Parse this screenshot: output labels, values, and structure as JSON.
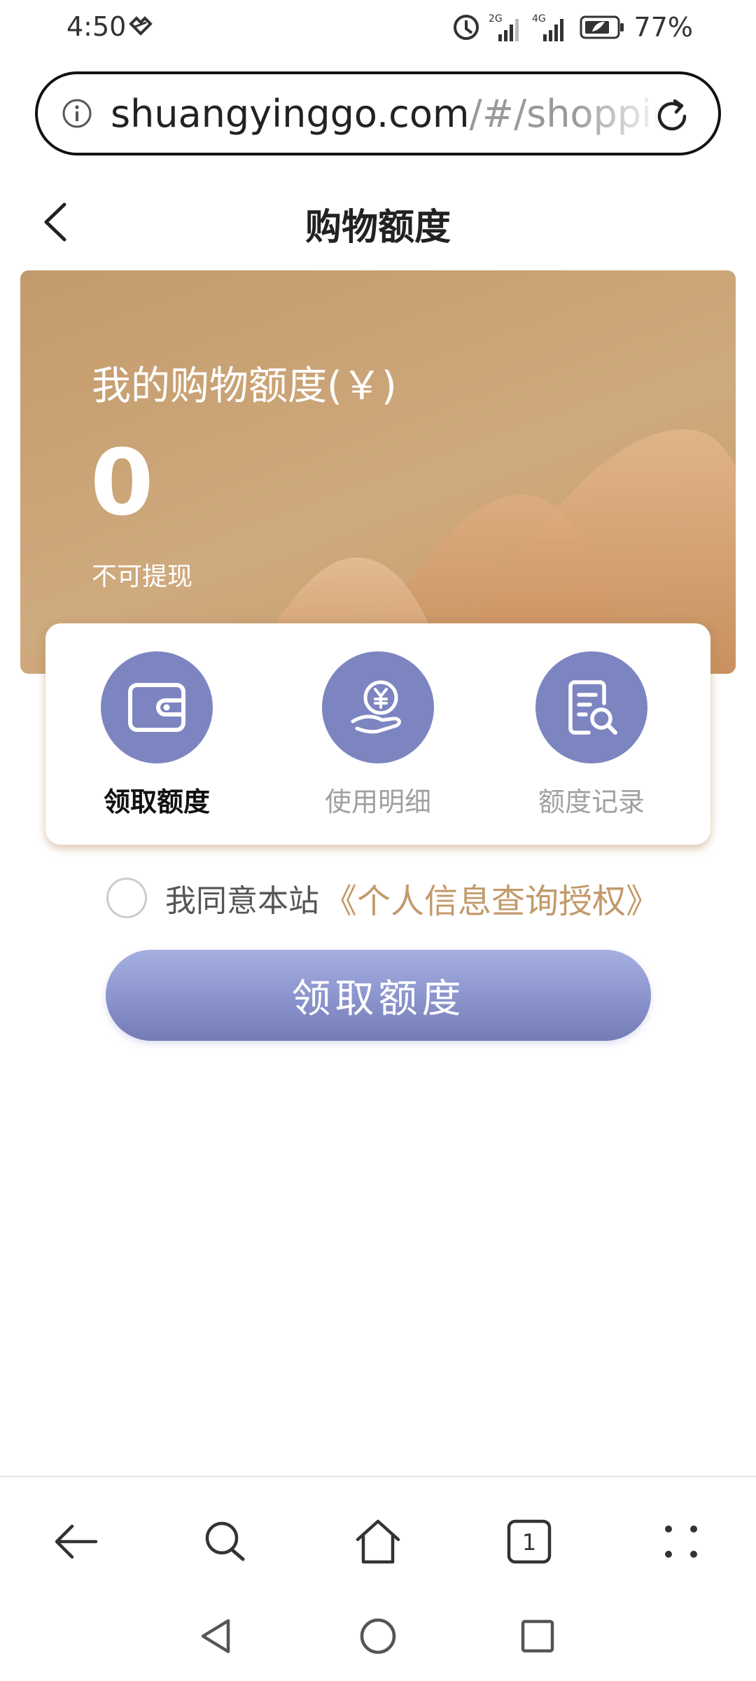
{
  "status_bar": {
    "time": "4:50",
    "network_1": "2G",
    "network_2": "4G",
    "battery_percent": "77%"
  },
  "url_bar": {
    "host": "shuangyinggo.com",
    "path": "/#/shoppir"
  },
  "header": {
    "title": "购物额度"
  },
  "banner": {
    "label": "我的购物额度(￥)",
    "amount": "0",
    "note": "不可提现"
  },
  "actions": [
    {
      "label": "领取额度",
      "icon": "wallet-icon",
      "active": true
    },
    {
      "label": "使用明细",
      "icon": "yuan-hand-icon",
      "active": false
    },
    {
      "label": "额度记录",
      "icon": "document-search-icon",
      "active": false
    }
  ],
  "agreement": {
    "text": "我同意本站",
    "link": "《个人信息查询授权》",
    "checked": false
  },
  "claim_button": {
    "label": "领取额度"
  },
  "browser_nav": {
    "tab_count": "1"
  },
  "colors": {
    "banner": "#c39a6b",
    "accent_purple": "#7d85c1",
    "link_gold": "#c39a6b"
  }
}
